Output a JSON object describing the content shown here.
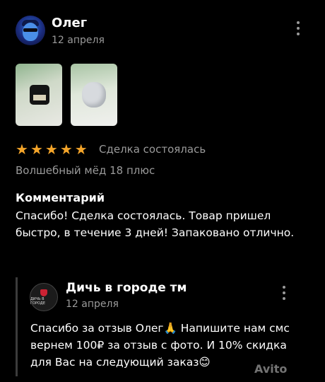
{
  "review": {
    "author": "Олег",
    "date": "12 апреля",
    "rating": 5,
    "status": "Сделка состоялась",
    "headline": "Волшебный мёд 18 плюс",
    "comment_title": "Комментарий",
    "comment": "Спасибо! Сделка состоялась. Товар пришел быстро, в течение 3 дней! Запаковано отлично."
  },
  "reply": {
    "author": "Дичь в городе тм",
    "date": "12 апреля",
    "logo_text": "ДИЧЬ В ГОРОДЕ",
    "text": "Спасибо за отзыв Олег🙏 Напишите нам смс вернем 100₽ за отзыв с фото. И 10% скидка для Вас на следующий заказ😊"
  },
  "photos": [
    {
      "icon": "honey-jar-photo"
    },
    {
      "icon": "packaging-photo"
    }
  ],
  "colors": {
    "background": "#000000",
    "star": "#f4a52a",
    "muted": "#9a9a9a"
  },
  "watermark": "Avito"
}
